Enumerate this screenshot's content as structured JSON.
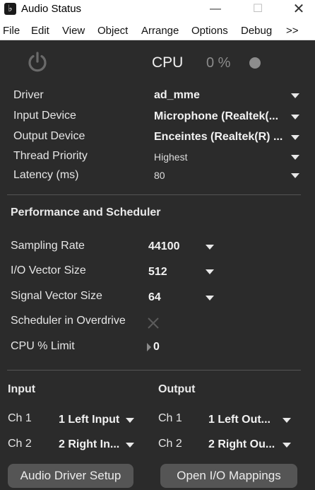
{
  "window": {
    "title": "Audio Status",
    "app_icon": "max-logo-icon"
  },
  "menu": [
    "File",
    "Edit",
    "View",
    "Object",
    "Arrange",
    "Options",
    "Debug",
    ">>"
  ],
  "status": {
    "cpu_label": "CPU",
    "cpu_value": "0 %"
  },
  "settings": {
    "driver": {
      "label": "Driver",
      "value": "ad_mme"
    },
    "input_device": {
      "label": "Input Device",
      "value": "Microphone (Realtek(..."
    },
    "output_device": {
      "label": "Output Device",
      "value": "Enceintes (Realtek(R) ..."
    },
    "thread_priority": {
      "label": "Thread Priority",
      "value": "Highest"
    },
    "latency": {
      "label": "Latency (ms)",
      "value": "80"
    }
  },
  "perf": {
    "title": "Performance and Scheduler",
    "sampling_rate": {
      "label": "Sampling Rate",
      "value": "44100"
    },
    "io_vector": {
      "label": "I/O Vector Size",
      "value": "512"
    },
    "signal_vector": {
      "label": "Signal Vector Size",
      "value": "64"
    },
    "overdrive": {
      "label": "Scheduler in Overdrive"
    },
    "cpu_limit": {
      "label": "CPU % Limit",
      "value": "0"
    }
  },
  "input": {
    "title": "Input",
    "ch1": {
      "label": "Ch 1",
      "value": "1 Left Input"
    },
    "ch2": {
      "label": "Ch 2",
      "value": "2 Right In..."
    }
  },
  "output": {
    "title": "Output",
    "ch1": {
      "label": "Ch 1",
      "value": "1 Left Out..."
    },
    "ch2": {
      "label": "Ch 2",
      "value": "2 Right Ou..."
    }
  },
  "buttons": {
    "driver_setup": "Audio Driver Setup",
    "io_mappings": "Open I/O Mappings"
  }
}
